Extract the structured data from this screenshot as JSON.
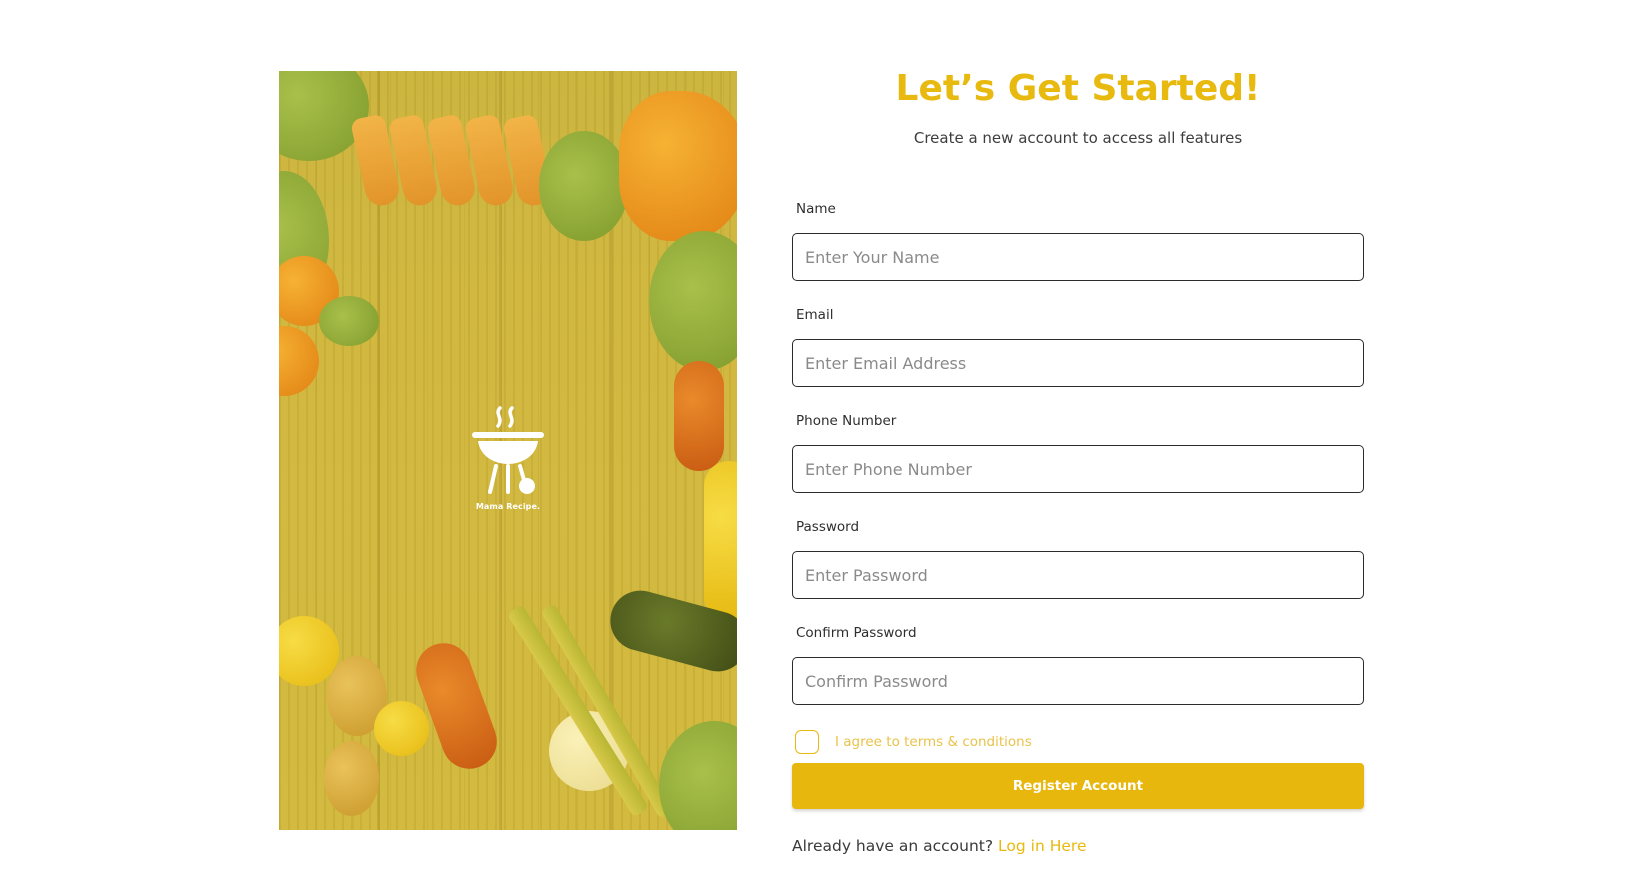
{
  "brand": {
    "name": "Mama Recipe.",
    "accent_color": "#e8b90f",
    "logo_icon": "grill-icon"
  },
  "page": {
    "title": "Let’s Get Started!",
    "subtitle": "Create a new account to access all features"
  },
  "form": {
    "fields": [
      {
        "label": "Name",
        "placeholder": "Enter Your Name",
        "value": ""
      },
      {
        "label": "Email",
        "placeholder": "Enter Email Address",
        "value": ""
      },
      {
        "label": "Phone Number",
        "placeholder": "Enter Phone Number",
        "value": ""
      },
      {
        "label": "Password",
        "placeholder": "Enter Password",
        "value": ""
      },
      {
        "label": "Confirm Password",
        "placeholder": "Confirm Password",
        "value": ""
      }
    ],
    "terms_label": "I agree to terms & conditions",
    "terms_checked": false,
    "submit_label": "Register Account"
  },
  "footer": {
    "prompt": "Already have an account?",
    "link_label": "Log in Here"
  }
}
